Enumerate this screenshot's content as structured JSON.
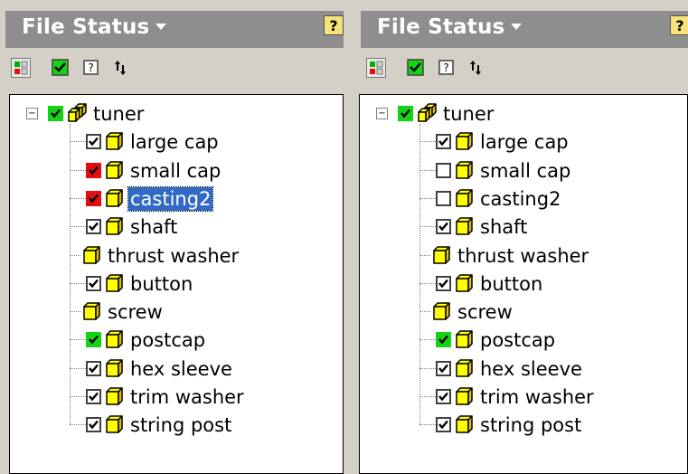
{
  "panels": [
    {
      "title": "File Status",
      "help": "?",
      "toolbar": {
        "filter": "filter-icon",
        "check": "check-icon",
        "info": "info-icon",
        "refresh": "refresh-icon"
      },
      "root": {
        "label": "tuner",
        "check": "green"
      },
      "items": [
        {
          "label": "large cap",
          "check": "checked"
        },
        {
          "label": "small cap",
          "check": "red"
        },
        {
          "label": "casting2",
          "check": "red",
          "selected": true
        },
        {
          "label": "shaft",
          "check": "checked"
        },
        {
          "label": "thrust washer",
          "check": "none"
        },
        {
          "label": "button",
          "check": "checked"
        },
        {
          "label": "screw",
          "check": "none"
        },
        {
          "label": "postcap",
          "check": "green"
        },
        {
          "label": "hex sleeve",
          "check": "checked"
        },
        {
          "label": "trim washer",
          "check": "checked"
        },
        {
          "label": "string post",
          "check": "checked"
        }
      ]
    },
    {
      "title": "File Status",
      "help": "?",
      "toolbar": {
        "filter": "filter-icon",
        "check": "check-icon",
        "info": "info-icon",
        "refresh": "refresh-icon"
      },
      "root": {
        "label": "tuner",
        "check": "green"
      },
      "items": [
        {
          "label": "large cap",
          "check": "checked"
        },
        {
          "label": "small cap",
          "check": "unchecked"
        },
        {
          "label": "casting2",
          "check": "unchecked"
        },
        {
          "label": "shaft",
          "check": "checked"
        },
        {
          "label": "thrust washer",
          "check": "none"
        },
        {
          "label": "button",
          "check": "checked"
        },
        {
          "label": "screw",
          "check": "none"
        },
        {
          "label": "postcap",
          "check": "green"
        },
        {
          "label": "hex sleeve",
          "check": "checked"
        },
        {
          "label": "trim washer",
          "check": "checked"
        },
        {
          "label": "string post",
          "check": "checked"
        }
      ]
    }
  ],
  "colors": {
    "header_bg": "#8e8e8e",
    "selection": "#316ac5",
    "check_green": "#14d214",
    "check_red": "#e01010",
    "part_yellow": "#ffff00"
  }
}
